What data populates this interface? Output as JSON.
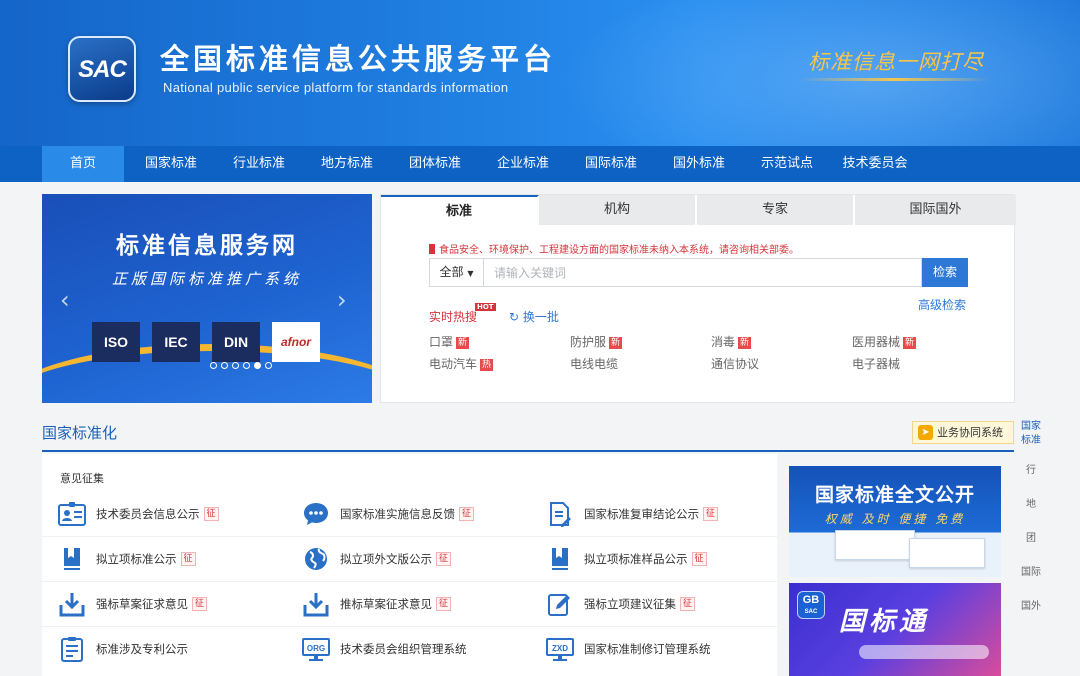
{
  "header": {
    "logo_text": "SAC",
    "title": "全国标准信息公共服务平台",
    "subtitle": "National public service platform  for standards information",
    "slogan": "标准信息一网打尽"
  },
  "nav": {
    "items": [
      {
        "label": "首页",
        "active": true
      },
      {
        "label": "国家标准"
      },
      {
        "label": "行业标准"
      },
      {
        "label": "地方标准"
      },
      {
        "label": "团体标准"
      },
      {
        "label": "企业标准"
      },
      {
        "label": "国际标准"
      },
      {
        "label": "国外标准"
      },
      {
        "label": "示范试点"
      },
      {
        "label": "技术委员会"
      }
    ]
  },
  "banner": {
    "title": "标准信息服务网",
    "subtitle": "正版国际标准推广系统",
    "logos": [
      "ISO",
      "IEC",
      "DIN",
      "afnor"
    ],
    "slide_count": 6,
    "active_slide": 5
  },
  "search": {
    "tabs": [
      {
        "label": "标准",
        "active": true
      },
      {
        "label": "机构"
      },
      {
        "label": "专家"
      },
      {
        "label": "国际国外"
      }
    ],
    "notice": "食品安全、环境保护、工程建设方面的国家标准未纳入本系统，请咨询相关部委。",
    "scope_label": "全部",
    "placeholder": "请输入关键词",
    "button_label": "检索",
    "advanced_label": "高级检索",
    "hot_label": "实时热搜",
    "hot_badge": "HOT",
    "refresh_label": "换一批",
    "hot_items": [
      {
        "label": "口罩",
        "tag": "新"
      },
      {
        "label": "防护服",
        "tag": "新"
      },
      {
        "label": "消毒",
        "tag": "新"
      },
      {
        "label": "医用器械",
        "tag": "新"
      },
      {
        "label": "电动汽车",
        "tag": "热"
      },
      {
        "label": "电线电缆",
        "tag": ""
      },
      {
        "label": "通信协议",
        "tag": ""
      },
      {
        "label": "电子器械",
        "tag": ""
      }
    ]
  },
  "section": {
    "title": "国家标准化",
    "biz_button": "业务协同系统",
    "subsection": "意见征集"
  },
  "sidebar": {
    "items": [
      "国家标准",
      "行",
      "地",
      "团",
      "国际",
      "国外"
    ]
  },
  "content": {
    "items": [
      {
        "label": "技术委员会信息公示",
        "tag": "征",
        "icon": "committee-card-icon"
      },
      {
        "label": "国家标准实施信息反馈",
        "tag": "征",
        "icon": "chat-bubble-icon"
      },
      {
        "label": "国家标准复审结论公示",
        "tag": "征",
        "icon": "document-edit-icon"
      },
      {
        "label": "拟立项标准公示",
        "tag": "征",
        "icon": "bookmark-book-icon"
      },
      {
        "label": "拟立项外文版公示",
        "tag": "征",
        "icon": "globe-icon"
      },
      {
        "label": "拟立项标准样品公示",
        "tag": "征",
        "icon": "bookmark-book-icon"
      },
      {
        "label": "强标草案征求意见",
        "tag": "征",
        "icon": "tray-download-icon"
      },
      {
        "label": "推标草案征求意见",
        "tag": "征",
        "icon": "tray-download-icon"
      },
      {
        "label": "强标立项建议征集",
        "tag": "征",
        "icon": "pencil-edit-icon"
      },
      {
        "label": "标准涉及专利公示",
        "tag": "",
        "icon": "patent-clipboard-icon"
      },
      {
        "label": "技术委员会组织管理系统",
        "tag": "",
        "icon": "org-monitor-icon"
      },
      {
        "label": "国家标准制修订管理系统",
        "tag": "",
        "icon": "zxd-monitor-icon"
      }
    ]
  },
  "ads": {
    "ad1_title": "国家标准全文公开",
    "ad1_subtitle": "权威 及时 便捷 免费",
    "ad2_logo": "GB",
    "ad2_logo_sub": "SAC",
    "ad2_title": "国标通"
  },
  "colors": {
    "brand_blue": "#1565c9",
    "nav_blue": "#0d62c4",
    "accent_red": "#d6343a",
    "link_blue": "#2d78d7",
    "slogan_gold": "#f6c54a"
  }
}
